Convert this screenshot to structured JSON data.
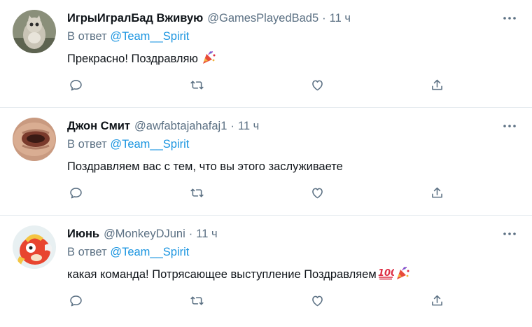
{
  "tweets": [
    {
      "display_name": "ИгрыИгралБад Вживую",
      "handle": "@GamesPlayedBad5",
      "separator": "·",
      "time": "11 ч",
      "reply_prefix": "В ответ",
      "reply_to": "@Team__Spirit",
      "text": "Прекрасно! Поздравляю",
      "emojis": [
        "party-popper-icon"
      ],
      "avatar": "cat-figure-avatar"
    },
    {
      "display_name": "Джон Смит",
      "handle": "@awfabtajahafaj1",
      "separator": "·",
      "time": "11 ч",
      "reply_prefix": "В ответ",
      "reply_to": "@Team__Spirit",
      "text": "Поздравляем вас с тем, что вы этого заслуживаете",
      "emojis": [],
      "avatar": "closeup-face-avatar"
    },
    {
      "display_name": "Июнь",
      "handle": "@MonkeyDJuni",
      "separator": "·",
      "time": "11 ч",
      "reply_prefix": "В ответ",
      "reply_to": "@Team__Spirit",
      "text": "какая команда! Потрясающее выступление Поздравляем",
      "emojis": [
        "hundred-points-icon",
        "party-popper-icon"
      ],
      "avatar": "magikarp-avatar"
    }
  ],
  "actions": [
    "reply-icon",
    "retweet-icon",
    "like-icon",
    "share-icon"
  ],
  "colors": {
    "text": "#0f1419",
    "secondary": "#5b7083",
    "link": "#1b95e0",
    "divider": "#e6ecf0",
    "icon": "#5b7083"
  }
}
